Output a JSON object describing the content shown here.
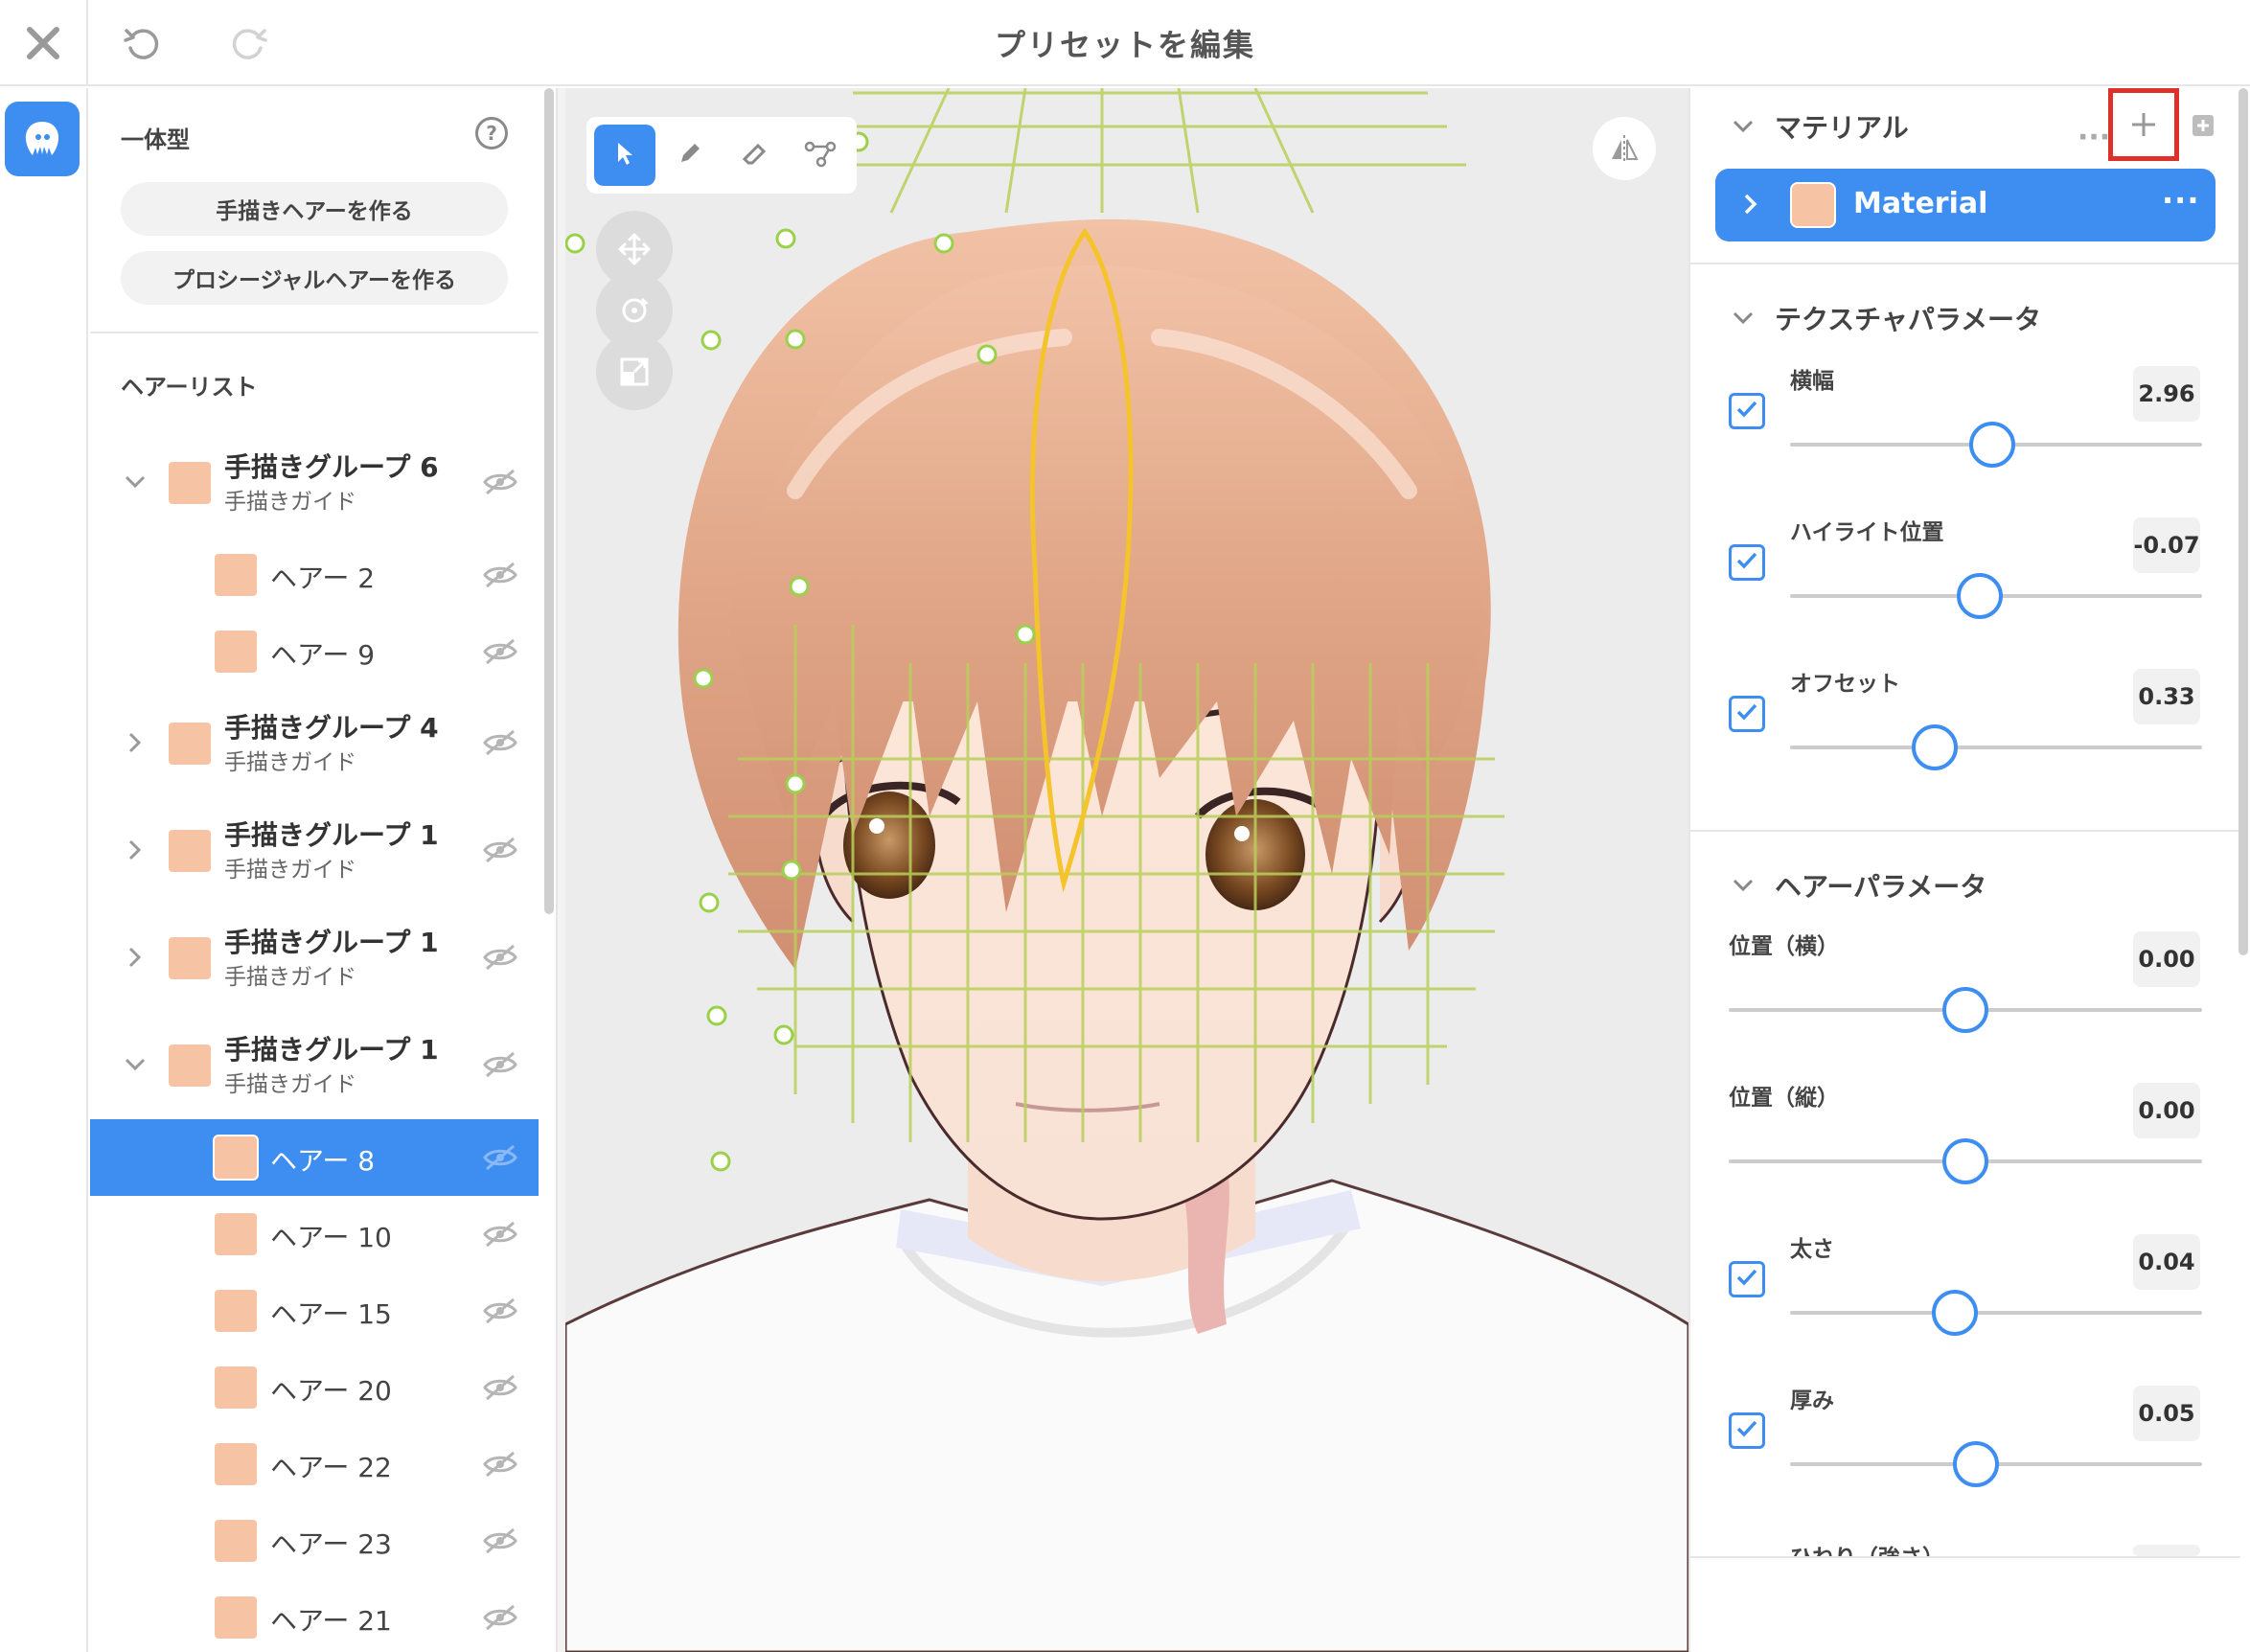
{
  "window": {
    "title": "プリセットを編集",
    "close_icon": "close-icon",
    "undo_icon": "undo-icon",
    "redo_icon": "redo-icon"
  },
  "rail": {
    "active_icon": "hair-head-icon"
  },
  "left_panel": {
    "section_title": "一体型",
    "help_label": "?",
    "buttons": [
      "手描きヘアーを作る",
      "プロシージャルヘアーを作る"
    ],
    "list_title": "ヘアーリスト",
    "swatch_color": "#f6c3a5",
    "hair_list": [
      {
        "type": "group",
        "name": "手描きグループ 6",
        "sub": "手描きガイド",
        "expanded": true
      },
      {
        "type": "hair",
        "name": "ヘアー 2"
      },
      {
        "type": "hair",
        "name": "ヘアー 9"
      },
      {
        "type": "group",
        "name": "手描きグループ 4",
        "sub": "手描きガイド",
        "expanded": false
      },
      {
        "type": "group",
        "name": "手描きグループ 1",
        "sub": "手描きガイド",
        "expanded": false
      },
      {
        "type": "group",
        "name": "手描きグループ 1",
        "sub": "手描きガイド",
        "expanded": false
      },
      {
        "type": "group",
        "name": "手描きグループ 1",
        "sub": "手描きガイド",
        "expanded": true
      },
      {
        "type": "hair",
        "name": "ヘアー 8",
        "selected": true
      },
      {
        "type": "hair",
        "name": "ヘアー 10"
      },
      {
        "type": "hair",
        "name": "ヘアー 15"
      },
      {
        "type": "hair",
        "name": "ヘアー 20"
      },
      {
        "type": "hair",
        "name": "ヘアー 22"
      },
      {
        "type": "hair",
        "name": "ヘアー 23"
      },
      {
        "type": "hair",
        "name": "ヘアー 21"
      }
    ]
  },
  "viewport": {
    "tools": [
      "select-tool-icon",
      "pen-tool-icon",
      "eraser-tool-icon",
      "path-tool-icon"
    ],
    "side_buttons": [
      "move-icon",
      "rotate-icon",
      "scale-icon"
    ],
    "mirror_icon": "mirror-icon"
  },
  "right_panel": {
    "accent": "#3d8ef0",
    "highlight_box": "#e0302a",
    "material": {
      "title": "マテリアル",
      "more_label": "···",
      "add_label": "+",
      "item_name": "Material",
      "item_more": "···"
    },
    "texture": {
      "title": "テクスチャパラメータ",
      "params": [
        {
          "label": "横幅",
          "value": "2.96",
          "checked": true,
          "pos": 0.49
        },
        {
          "label": "ハイライト位置",
          "value": "-0.07",
          "checked": true,
          "pos": 0.46
        },
        {
          "label": "オフセット",
          "value": "0.33",
          "checked": true,
          "pos": 0.35
        }
      ]
    },
    "hair": {
      "title": "ヘアーパラメータ",
      "params": [
        {
          "label": "位置（横）",
          "value": "0.00",
          "checked": false,
          "pos": 0.5
        },
        {
          "label": "位置（縦）",
          "value": "0.00",
          "checked": false,
          "pos": 0.5
        },
        {
          "label": "太さ",
          "value": "0.04",
          "checked": true,
          "pos": 0.4
        },
        {
          "label": "厚み",
          "value": "0.05",
          "checked": true,
          "pos": 0.45
        }
      ],
      "partial_label": "ひねり（強さ）"
    }
  }
}
